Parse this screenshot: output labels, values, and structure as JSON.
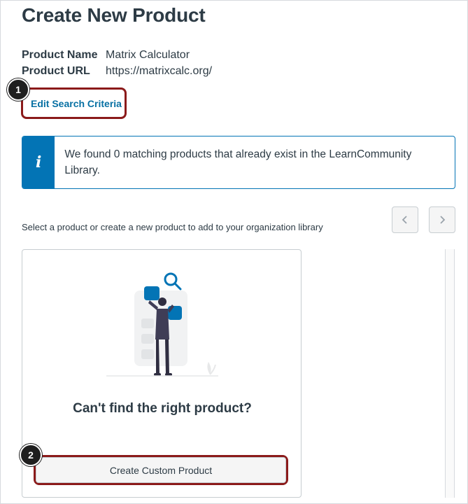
{
  "page": {
    "title": "Create New Product"
  },
  "product_info": {
    "name_label": "Product Name",
    "name_value": "Matrix Calculator",
    "url_label": "Product URL",
    "url_value": "https://matrixcalc.org/"
  },
  "edit_link": "Edit Search Criteria",
  "alert": {
    "icon": "i",
    "message": "We found 0 matching products that already exist in the LearnCommunity Library."
  },
  "select_prompt": "Select a product or create a new product to add to your organization library",
  "pager": {
    "prev_icon": "chevron-left-icon",
    "next_icon": "chevron-right-icon"
  },
  "card": {
    "heading": "Can't find the right product?",
    "button_label": "Create Custom Product"
  },
  "callouts": [
    "1",
    "2"
  ],
  "colors": {
    "accent_blue": "#0374b5",
    "link_blue": "#0770a3",
    "callout_border": "#8b1a1a",
    "text": "#2d3b45"
  }
}
